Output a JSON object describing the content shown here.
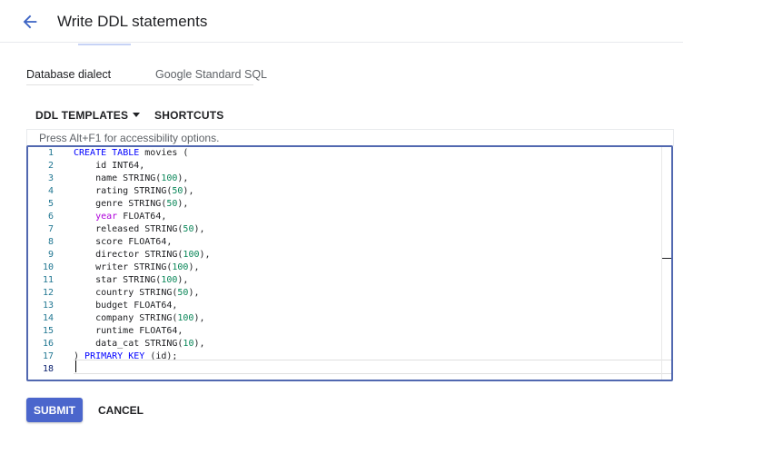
{
  "header": {
    "title": "Write DDL statements",
    "back_icon": "arrow-left-icon"
  },
  "dialect": {
    "label": "Database dialect",
    "value": "Google Standard SQL"
  },
  "toolbar": {
    "ddl_templates_label": "DDL TEMPLATES",
    "shortcuts_label": "SHORTCUTS"
  },
  "editor": {
    "hint": "Press Alt+F1 for accessibility options.",
    "active_line": 18,
    "lines": [
      "CREATE TABLE movies (",
      "    id INT64,",
      "    name STRING(100),",
      "    rating STRING(50),",
      "    genre STRING(50),",
      "    year FLOAT64,",
      "    released STRING(50),",
      "    score FLOAT64,",
      "    director STRING(100),",
      "    writer STRING(100),",
      "    star STRING(100),",
      "    country STRING(50),",
      "    budget FLOAT64,",
      "    company STRING(100),",
      "    runtime FLOAT64,",
      "    data_cat STRING(10),",
      ") PRIMARY KEY (id);",
      ""
    ]
  },
  "actions": {
    "submit_label": "SUBMIT",
    "cancel_label": "CANCEL"
  },
  "colors": {
    "accent": "#4b66cc",
    "editor_border": "#5168b0",
    "line_number": "#237893",
    "keyword": "#0000ff",
    "keyword_alt": "#af00db",
    "number": "#098658"
  }
}
